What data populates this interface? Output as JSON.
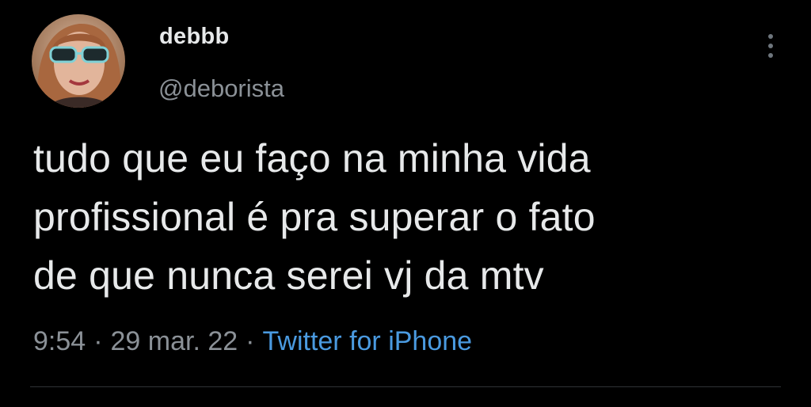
{
  "user": {
    "display_name": "debbb",
    "handle": "@deborista"
  },
  "tweet": {
    "lines": [
      "tudo que eu faço na minha vida",
      "profissional é pra superar o fato",
      "de que nunca serei vj da mtv"
    ],
    "time": "9:54",
    "date": "29 mar. 22",
    "separator": "·",
    "source": "Twitter for iPhone"
  },
  "icons": {
    "more": "more-vertical-icon",
    "avatar": "profile-photo"
  },
  "colors": {
    "background": "#000000",
    "text": "#e7e9ea",
    "secondary_text": "#8b9197",
    "link": "#4a9ae0",
    "divider": "#2f3336"
  }
}
